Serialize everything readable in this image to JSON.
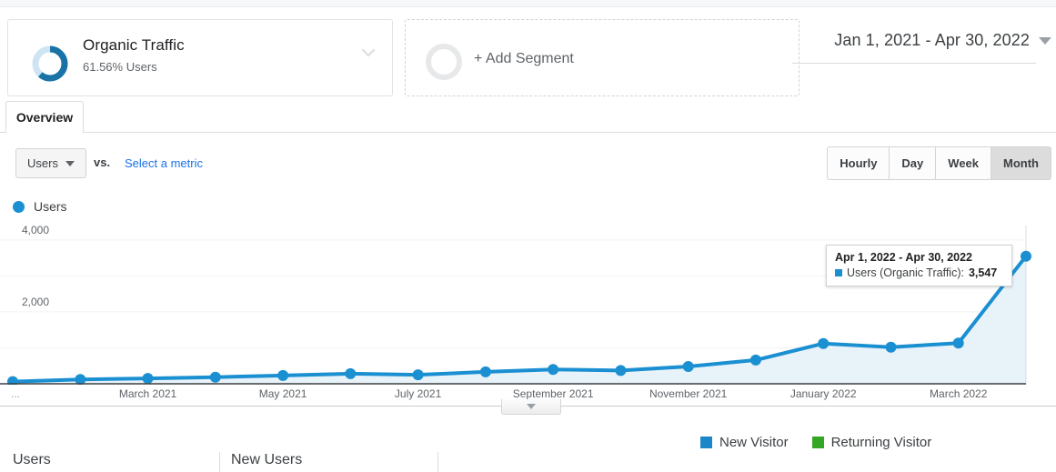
{
  "segment": {
    "name": "Organic Traffic",
    "sub": "61.56% Users",
    "percent": 61.56,
    "donut_dark": "#1a73a7",
    "donut_light": "#cfe4f2",
    "chevron_icon": "chevron-down-icon"
  },
  "add_segment": {
    "label": "+ Add Segment"
  },
  "date_range": {
    "label": "Jan 1, 2021 - Apr 30, 2022",
    "caret_icon": "caret-down-icon"
  },
  "tabs": [
    {
      "label": "Overview",
      "active": true
    }
  ],
  "controls": {
    "metric_button": "Users",
    "vs_label": "vs.",
    "select_metric": "Select a metric",
    "granularity": [
      {
        "label": "Hourly",
        "active": false
      },
      {
        "label": "Day",
        "active": false
      },
      {
        "label": "Week",
        "active": false
      },
      {
        "label": "Month",
        "active": true
      }
    ]
  },
  "chart_legend": {
    "label": "Users",
    "color": "#1a8fd1"
  },
  "tooltip": {
    "title": "Apr 1, 2022 - Apr 30, 2022",
    "series_label": "Users (Organic Traffic):",
    "value": "3,547",
    "swatch_color": "#1a8fd1"
  },
  "bottom_legend": [
    {
      "label": "New Visitor",
      "color": "#1b86c8"
    },
    {
      "label": "Returning Visitor",
      "color": "#34a524"
    }
  ],
  "bottom_metrics": [
    {
      "label": "Users"
    },
    {
      "label": "New Users"
    }
  ],
  "expander": {
    "icon": "caret-down-icon"
  },
  "chart_data": {
    "type": "line",
    "title": "Users",
    "xlabel": "",
    "ylabel": "Users",
    "ylim": [
      0,
      4400
    ],
    "grid": true,
    "legend_position": "top-left",
    "line_color": "#1a8fd1",
    "fill_color": "#e8f2f9",
    "ytick_values": [
      2000,
      4000
    ],
    "ytick_labels": [
      "2,000",
      "4,000"
    ],
    "gridlines": [
      1000,
      2000,
      3000,
      4000
    ],
    "x_tick_labels": [
      "...",
      "March 2021",
      "May 2021",
      "July 2021",
      "September 2021",
      "November 2021",
      "January 2022",
      "March 2022"
    ],
    "categories": [
      "January 2021",
      "February 2021",
      "March 2021",
      "April 2021",
      "May 2021",
      "June 2021",
      "July 2021",
      "August 2021",
      "September 2021",
      "October 2021",
      "November 2021",
      "December 2021",
      "January 2022",
      "February 2022",
      "March 2022",
      "April 2022"
    ],
    "values": [
      60,
      120,
      150,
      185,
      230,
      280,
      250,
      330,
      400,
      370,
      480,
      660,
      1120,
      1020,
      1130,
      3547
    ],
    "annotations": [
      {
        "category": "April 2022",
        "text": "Apr 1, 2022 - Apr 30, 2022 — Users (Organic Traffic): 3,547"
      }
    ]
  }
}
